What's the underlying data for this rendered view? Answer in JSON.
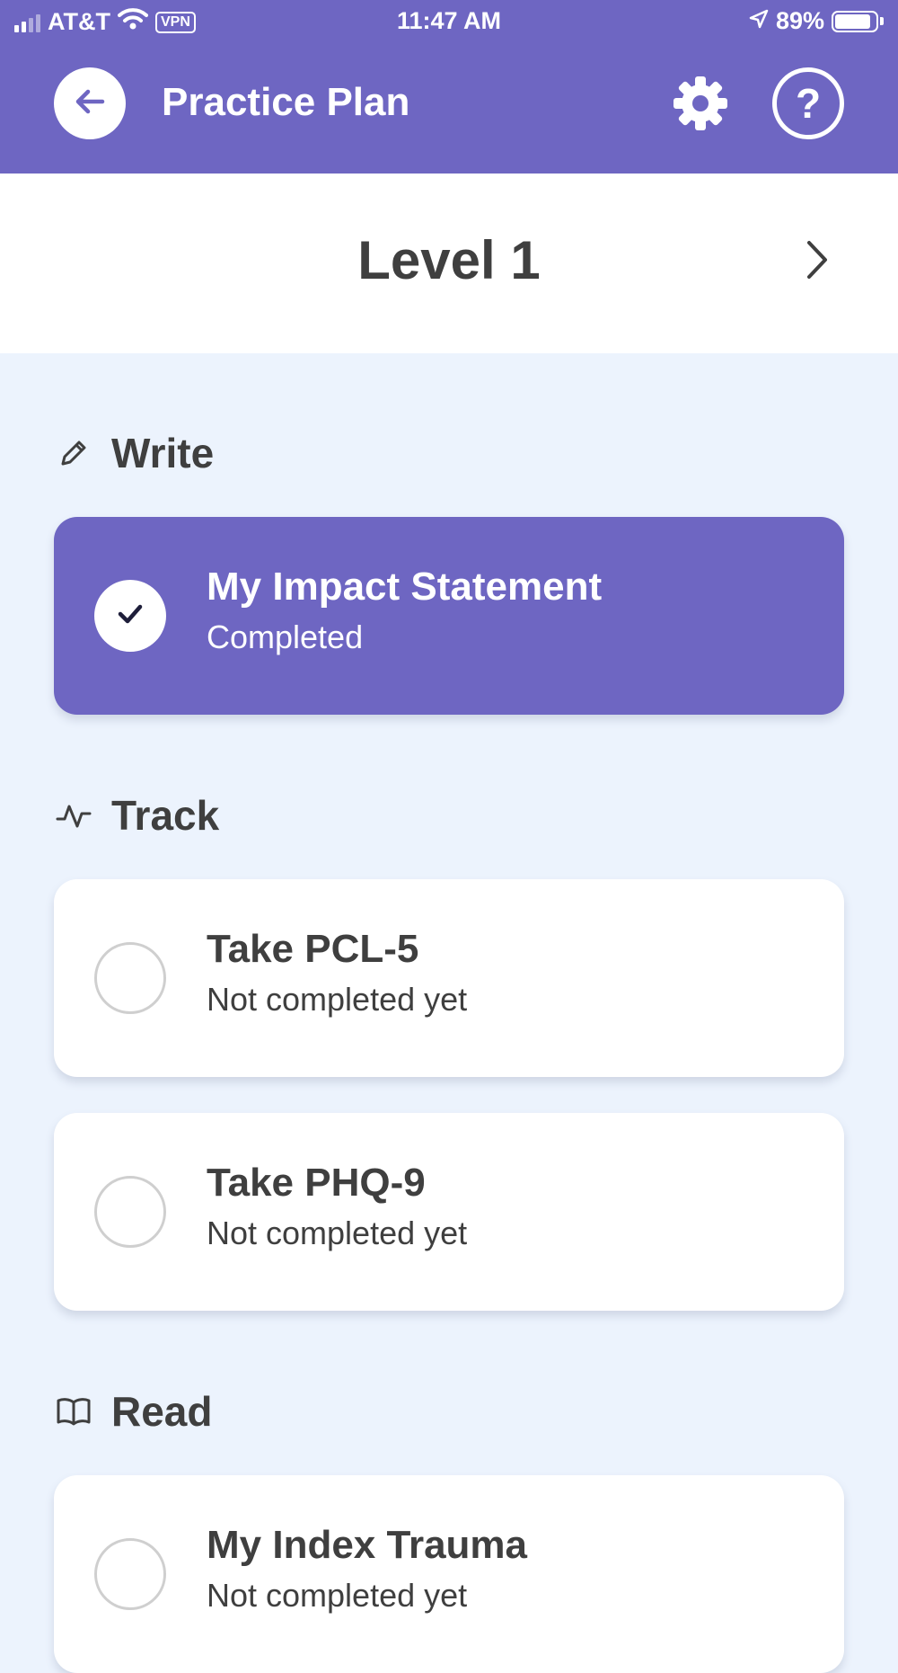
{
  "status_bar": {
    "carrier": "AT&T",
    "vpn": "VPN",
    "time": "11:47 AM",
    "battery": "89%",
    "battery_level": 0.89
  },
  "header": {
    "title": "Practice Plan",
    "back_icon": "arrow-left-icon",
    "settings_icon": "gear-icon",
    "help_icon": "help-icon",
    "help_label": "?"
  },
  "level": {
    "title": "Level 1",
    "next_icon": "chevron-right-icon"
  },
  "sections": {
    "write": {
      "title": "Write",
      "icon": "pencil-icon",
      "items": [
        {
          "title": "My Impact Statement",
          "status": "Completed",
          "completed": true
        }
      ]
    },
    "track": {
      "title": "Track",
      "icon": "pulse-icon",
      "items": [
        {
          "title": "Take PCL-5",
          "status": "Not completed yet",
          "completed": false
        },
        {
          "title": "Take PHQ-9",
          "status": "Not completed yet",
          "completed": false
        }
      ]
    },
    "read": {
      "title": "Read",
      "icon": "book-icon",
      "items": [
        {
          "title": "My Index Trauma",
          "status": "Not completed yet",
          "completed": false
        }
      ]
    }
  },
  "colors": {
    "primary": "#6E66C2",
    "background": "#ECF3FD",
    "text": "#3F3F3F"
  }
}
